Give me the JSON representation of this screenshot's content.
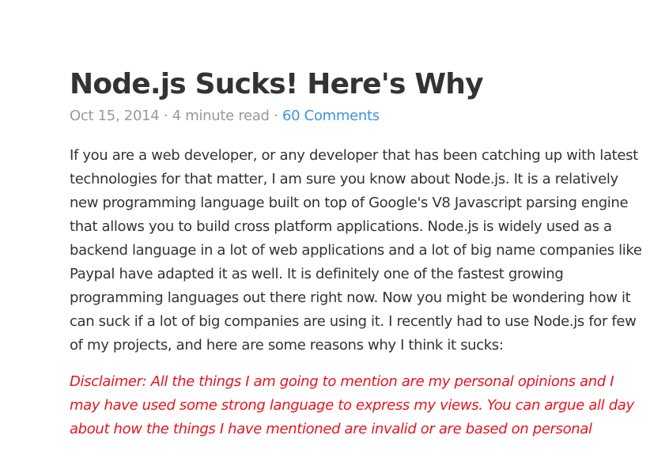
{
  "post": {
    "title": "Node.js Sucks! Here's Why",
    "date": "Oct 15, 2014",
    "separator": " · ",
    "read_time": "4 minute read",
    "comments_link": "60 Comments",
    "paragraphs": [
      "If you are a web developer, or any developer that has been catching up with latest technologies for that matter, I am sure you know about Node.js. It is a relatively new programming language built on top of Google's V8 Javascript parsing engine that allows you to build cross platform applications. Node.js is widely used as a backend language in a lot of web applications and a lot of big name companies like Paypal have adapted it as well. It is definitely one of the fastest growing programming languages out there right now. Now you might be wondering how it can suck if a lot of big companies are using it. I recently had to use Node.js for few of my projects, and here are some reasons why I think it sucks:"
    ],
    "disclaimer": "Disclaimer: All the things I am going to mention are my personal opinions and I may have used some strong language to express my views. You can argue all day about how the things I have mentioned are invalid or are based on personal"
  },
  "colors": {
    "text": "#333333",
    "meta": "#999999",
    "link": "#3a96dd",
    "disclaimer": "#e8141e"
  }
}
